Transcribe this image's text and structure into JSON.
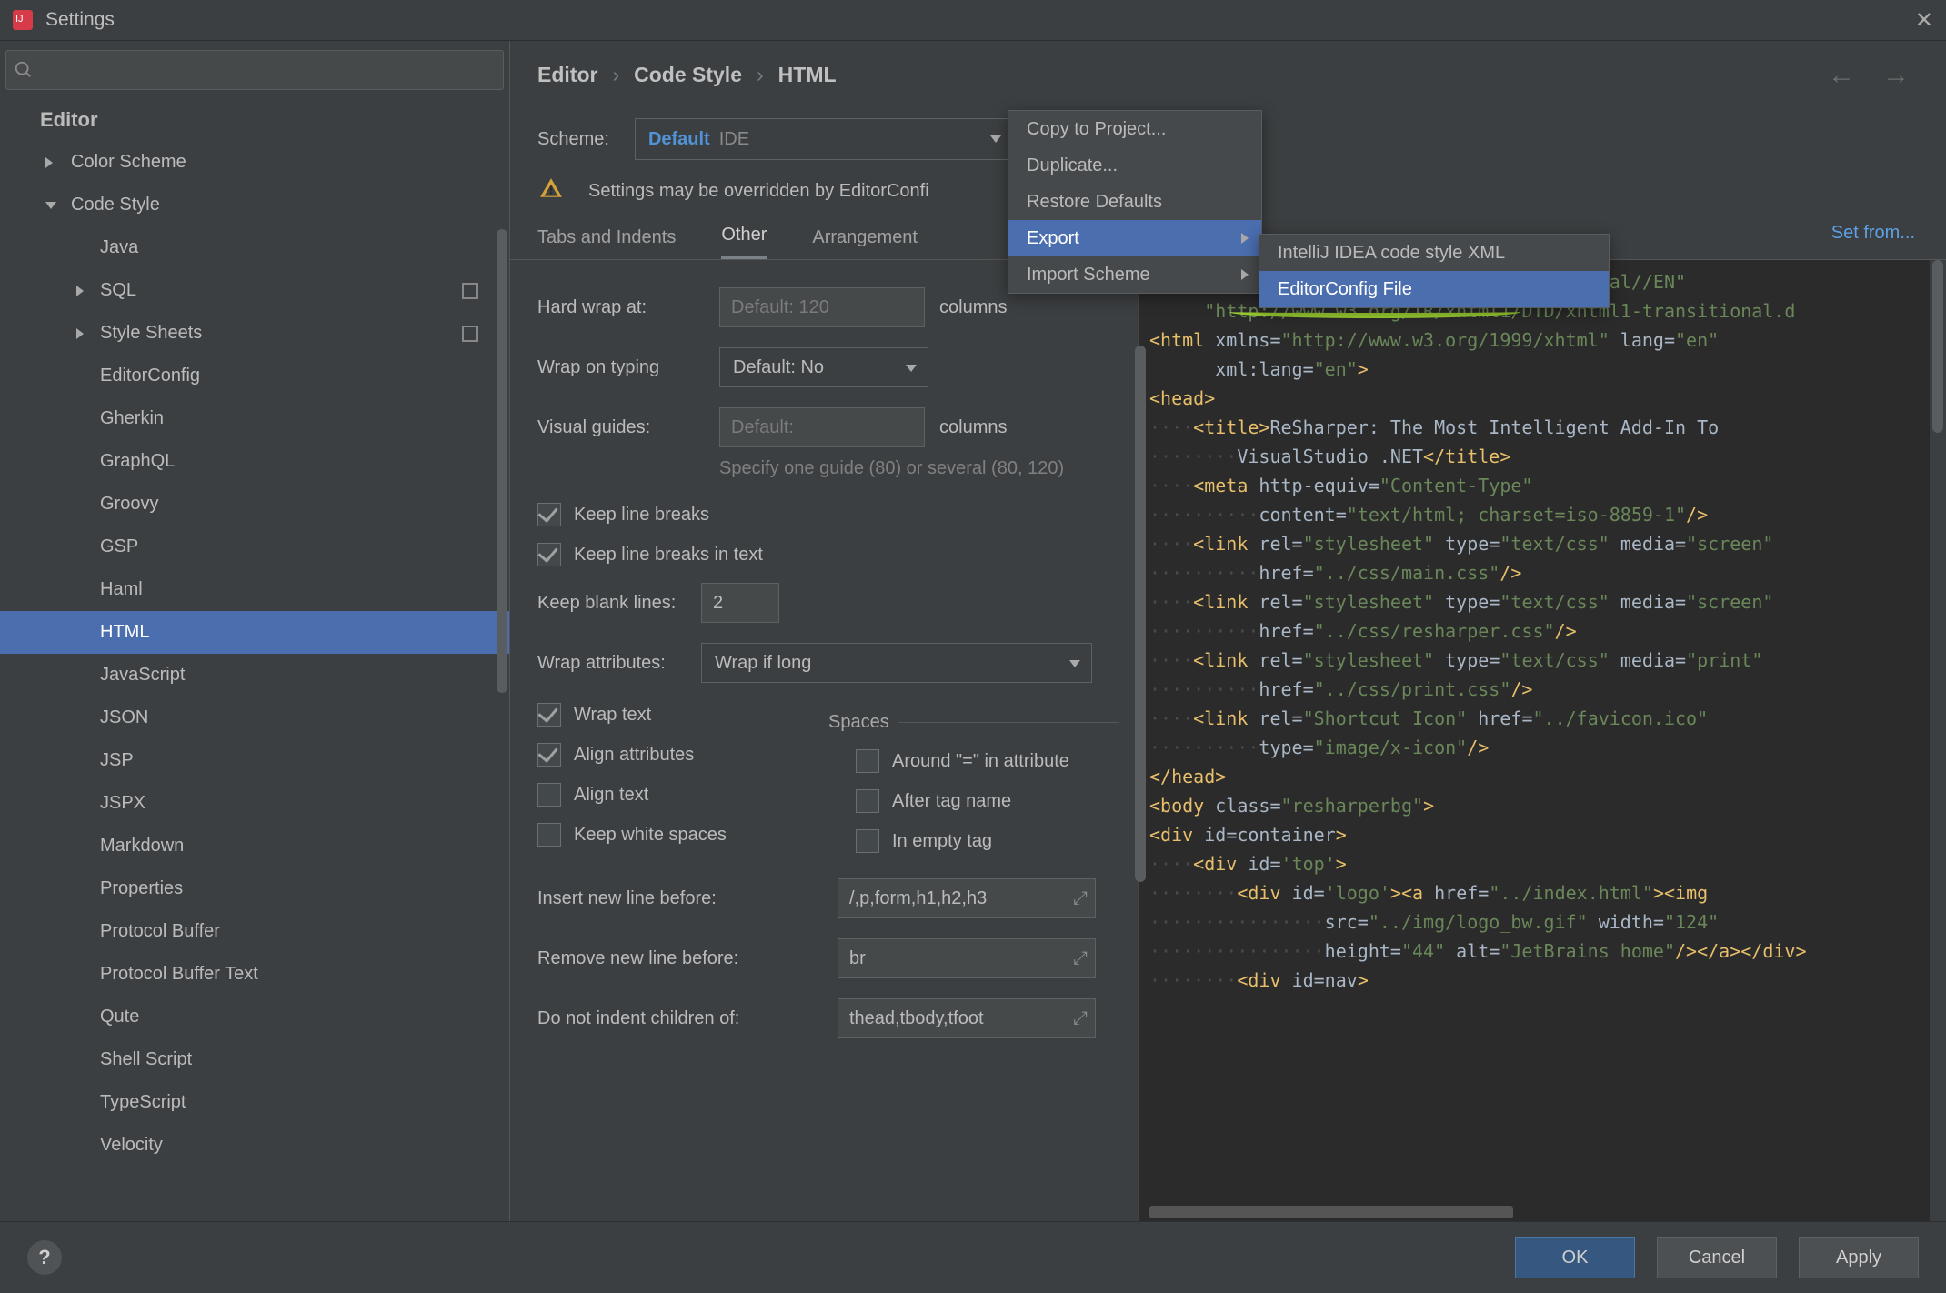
{
  "window": {
    "title": "Settings"
  },
  "sidebar": {
    "heading": "Editor",
    "items": [
      {
        "label": "Color Scheme",
        "indent": 2,
        "chev": "right"
      },
      {
        "label": "Code Style",
        "indent": 2,
        "chev": "down"
      },
      {
        "label": "Java",
        "indent": 3
      },
      {
        "label": "SQL",
        "indent": 3,
        "chev": "right",
        "badge": true
      },
      {
        "label": "Style Sheets",
        "indent": 3,
        "chev": "right",
        "badge": true
      },
      {
        "label": "EditorConfig",
        "indent": 3
      },
      {
        "label": "Gherkin",
        "indent": 3
      },
      {
        "label": "GraphQL",
        "indent": 3
      },
      {
        "label": "Groovy",
        "indent": 3
      },
      {
        "label": "GSP",
        "indent": 3
      },
      {
        "label": "Haml",
        "indent": 3
      },
      {
        "label": "HTML",
        "indent": 3,
        "selected": true
      },
      {
        "label": "JavaScript",
        "indent": 3
      },
      {
        "label": "JSON",
        "indent": 3
      },
      {
        "label": "JSP",
        "indent": 3
      },
      {
        "label": "JSPX",
        "indent": 3
      },
      {
        "label": "Markdown",
        "indent": 3
      },
      {
        "label": "Properties",
        "indent": 3
      },
      {
        "label": "Protocol Buffer",
        "indent": 3
      },
      {
        "label": "Protocol Buffer Text",
        "indent": 3
      },
      {
        "label": "Qute",
        "indent": 3
      },
      {
        "label": "Shell Script",
        "indent": 3
      },
      {
        "label": "TypeScript",
        "indent": 3
      },
      {
        "label": "Velocity",
        "indent": 3
      }
    ]
  },
  "breadcrumb": [
    "Editor",
    "Code Style",
    "HTML"
  ],
  "scheme": {
    "label": "Scheme:",
    "value_main": "Default",
    "value_suffix": "IDE"
  },
  "warning": "Settings may be overridden by EditorConfi",
  "set_from": "Set from...",
  "tabs": [
    "Tabs and Indents",
    "Other",
    "Arrangement"
  ],
  "active_tab": 1,
  "form": {
    "hard_wrap_label": "Hard wrap at:",
    "hard_wrap_placeholder": "Default: 120",
    "columns": "columns",
    "wrap_on_typing_label": "Wrap on typing",
    "wrap_on_typing_value": "Default: No",
    "visual_guides_label": "Visual guides:",
    "visual_guides_placeholder": "Default:",
    "visual_guides_hint": "Specify one guide (80) or several (80, 120)",
    "keep_line_breaks": "Keep line breaks",
    "keep_line_breaks_text": "Keep line breaks in text",
    "keep_blank_lines_label": "Keep blank lines:",
    "keep_blank_lines_value": "2",
    "wrap_attributes_label": "Wrap attributes:",
    "wrap_attributes_value": "Wrap if long",
    "wrap_text": "Wrap text",
    "align_attributes": "Align attributes",
    "align_text": "Align text",
    "keep_white_spaces": "Keep white spaces",
    "spaces_heading": "Spaces",
    "around_eq": "Around \"=\" in attribute",
    "after_tag_name": "After tag name",
    "in_empty_tag": "In empty tag",
    "insert_new_line_before_label": "Insert new line before:",
    "insert_new_line_before_value": "/,p,form,h1,h2,h3",
    "remove_new_line_before_label": "Remove new line before:",
    "remove_new_line_before_value": "br",
    "do_not_indent_label": "Do not indent children of:",
    "do_not_indent_value": "thead,tbody,tfoot"
  },
  "popup1": {
    "items": [
      {
        "label": "Copy to Project..."
      },
      {
        "label": "Duplicate..."
      },
      {
        "label": "Restore Defaults"
      },
      {
        "label": "Export",
        "sub": true,
        "hover": true
      },
      {
        "label": "Import Scheme",
        "sub": true
      }
    ]
  },
  "popup2": {
    "items": [
      {
        "label": "IntelliJ IDEA code style XML"
      },
      {
        "label": "EditorConfig File",
        "hover": true
      }
    ]
  },
  "footer": {
    "ok": "OK",
    "cancel": "Cancel",
    "apply": "Apply"
  },
  "code": [
    {
      "pre": "                                     ",
      "parts": [
        {
          "t": "itional//EN\"",
          "c": "str"
        }
      ]
    },
    {
      "pre": "     ",
      "parts": [
        {
          "t": "\"http://www.w3.org/TR/xhtml1/DTD/xhtml1-transitional.d",
          "c": "str"
        }
      ]
    },
    {
      "pre": "",
      "parts": [
        {
          "t": "<html ",
          "c": "tag"
        },
        {
          "t": "xmlns",
          "c": "attr"
        },
        {
          "t": "=",
          "c": "attr"
        },
        {
          "t": "\"http://www.w3.org/1999/xhtml\"",
          "c": "str"
        },
        {
          "t": " lang",
          "c": "attr"
        },
        {
          "t": "=",
          "c": "attr"
        },
        {
          "t": "\"en\"",
          "c": "str"
        }
      ]
    },
    {
      "pre": "      ",
      "parts": [
        {
          "t": "xml:lang",
          "c": "attr"
        },
        {
          "t": "=",
          "c": "attr"
        },
        {
          "t": "\"en\"",
          "c": "str"
        },
        {
          "t": ">",
          "c": "tag"
        }
      ]
    },
    {
      "pre": "",
      "parts": [
        {
          "t": "<head>",
          "c": "tag"
        }
      ]
    },
    {
      "pre": "....",
      "parts": [
        {
          "t": "<title>",
          "c": "tag"
        },
        {
          "t": "ReSharper: The Most Intelligent Add-In To",
          "c": "attr"
        }
      ]
    },
    {
      "pre": "........",
      "parts": [
        {
          "t": "VisualStudio .NET",
          "c": "attr"
        },
        {
          "t": "</title>",
          "c": "tag"
        }
      ]
    },
    {
      "pre": "....",
      "parts": [
        {
          "t": "<meta ",
          "c": "tag"
        },
        {
          "t": "http-equiv",
          "c": "attr"
        },
        {
          "t": "=",
          "c": "attr"
        },
        {
          "t": "\"Content-Type\"",
          "c": "str"
        }
      ]
    },
    {
      "pre": "..........",
      "parts": [
        {
          "t": "content",
          "c": "attr"
        },
        {
          "t": "=",
          "c": "attr"
        },
        {
          "t": "\"text/html; charset=iso-8859-1\"",
          "c": "str"
        },
        {
          "t": "/>",
          "c": "tag"
        }
      ]
    },
    {
      "pre": "....",
      "parts": [
        {
          "t": "<link ",
          "c": "tag"
        },
        {
          "t": "rel",
          "c": "attr"
        },
        {
          "t": "=",
          "c": "attr"
        },
        {
          "t": "\"stylesheet\"",
          "c": "str"
        },
        {
          "t": " type",
          "c": "attr"
        },
        {
          "t": "=",
          "c": "attr"
        },
        {
          "t": "\"text/css\"",
          "c": "str"
        },
        {
          "t": " media",
          "c": "attr"
        },
        {
          "t": "=",
          "c": "attr"
        },
        {
          "t": "\"screen\"",
          "c": "str"
        }
      ]
    },
    {
      "pre": "..........",
      "parts": [
        {
          "t": "href",
          "c": "attr"
        },
        {
          "t": "=",
          "c": "attr"
        },
        {
          "t": "\"../css/main.css\"",
          "c": "str"
        },
        {
          "t": "/>",
          "c": "tag"
        }
      ]
    },
    {
      "pre": "....",
      "parts": [
        {
          "t": "<link ",
          "c": "tag"
        },
        {
          "t": "rel",
          "c": "attr"
        },
        {
          "t": "=",
          "c": "attr"
        },
        {
          "t": "\"stylesheet\"",
          "c": "str"
        },
        {
          "t": " type",
          "c": "attr"
        },
        {
          "t": "=",
          "c": "attr"
        },
        {
          "t": "\"text/css\"",
          "c": "str"
        },
        {
          "t": " media",
          "c": "attr"
        },
        {
          "t": "=",
          "c": "attr"
        },
        {
          "t": "\"screen\"",
          "c": "str"
        }
      ]
    },
    {
      "pre": "..........",
      "parts": [
        {
          "t": "href",
          "c": "attr"
        },
        {
          "t": "=",
          "c": "attr"
        },
        {
          "t": "\"../css/resharper.css\"",
          "c": "str"
        },
        {
          "t": "/>",
          "c": "tag"
        }
      ]
    },
    {
      "pre": "....",
      "parts": [
        {
          "t": "<link ",
          "c": "tag"
        },
        {
          "t": "rel",
          "c": "attr"
        },
        {
          "t": "=",
          "c": "attr"
        },
        {
          "t": "\"stylesheet\"",
          "c": "str"
        },
        {
          "t": " type",
          "c": "attr"
        },
        {
          "t": "=",
          "c": "attr"
        },
        {
          "t": "\"text/css\"",
          "c": "str"
        },
        {
          "t": " media",
          "c": "attr"
        },
        {
          "t": "=",
          "c": "attr"
        },
        {
          "t": "\"print\"",
          "c": "str"
        }
      ]
    },
    {
      "pre": "..........",
      "parts": [
        {
          "t": "href",
          "c": "attr"
        },
        {
          "t": "=",
          "c": "attr"
        },
        {
          "t": "\"../css/print.css\"",
          "c": "str"
        },
        {
          "t": "/>",
          "c": "tag"
        }
      ]
    },
    {
      "pre": "....",
      "parts": [
        {
          "t": "<link ",
          "c": "tag"
        },
        {
          "t": "rel",
          "c": "attr"
        },
        {
          "t": "=",
          "c": "attr"
        },
        {
          "t": "\"Shortcut Icon\"",
          "c": "str"
        },
        {
          "t": " href",
          "c": "attr"
        },
        {
          "t": "=",
          "c": "attr"
        },
        {
          "t": "\"../favicon.ico\"",
          "c": "str"
        }
      ]
    },
    {
      "pre": "..........",
      "parts": [
        {
          "t": "type",
          "c": "attr"
        },
        {
          "t": "=",
          "c": "attr"
        },
        {
          "t": "\"image/x-icon\"",
          "c": "str"
        },
        {
          "t": "/>",
          "c": "tag"
        }
      ]
    },
    {
      "pre": "",
      "parts": []
    },
    {
      "pre": "",
      "parts": [
        {
          "t": "</head>",
          "c": "tag"
        }
      ]
    },
    {
      "pre": "",
      "parts": []
    },
    {
      "pre": "",
      "parts": [
        {
          "t": "<body ",
          "c": "tag"
        },
        {
          "t": "class",
          "c": "attr"
        },
        {
          "t": "=",
          "c": "attr"
        },
        {
          "t": "\"resharperbg\"",
          "c": "str"
        },
        {
          "t": ">",
          "c": "tag"
        }
      ]
    },
    {
      "pre": "",
      "parts": [
        {
          "t": "<div ",
          "c": "tag"
        },
        {
          "t": "id",
          "c": "attr"
        },
        {
          "t": "=container",
          "c": "attr"
        },
        {
          "t": ">",
          "c": "tag"
        }
      ]
    },
    {
      "pre": "",
      "parts": []
    },
    {
      "pre": "....",
      "parts": [
        {
          "t": "<div ",
          "c": "tag"
        },
        {
          "t": "id",
          "c": "attr"
        },
        {
          "t": "=",
          "c": "attr"
        },
        {
          "t": "'top'",
          "c": "str"
        },
        {
          "t": ">",
          "c": "tag"
        }
      ]
    },
    {
      "pre": "........",
      "parts": [
        {
          "t": "<div ",
          "c": "tag"
        },
        {
          "t": "id",
          "c": "attr"
        },
        {
          "t": "=",
          "c": "attr"
        },
        {
          "t": "'logo'",
          "c": "str"
        },
        {
          "t": "><a ",
          "c": "tag"
        },
        {
          "t": "href",
          "c": "attr"
        },
        {
          "t": "=",
          "c": "attr"
        },
        {
          "t": "\"../index.html\"",
          "c": "str"
        },
        {
          "t": "><img",
          "c": "tag"
        }
      ]
    },
    {
      "pre": "................",
      "parts": [
        {
          "t": "src",
          "c": "attr"
        },
        {
          "t": "=",
          "c": "attr"
        },
        {
          "t": "\"../img/logo_bw.gif\"",
          "c": "str"
        },
        {
          "t": " width",
          "c": "attr"
        },
        {
          "t": "=",
          "c": "attr"
        },
        {
          "t": "\"124\"",
          "c": "str"
        }
      ]
    },
    {
      "pre": "................",
      "parts": [
        {
          "t": "height",
          "c": "attr"
        },
        {
          "t": "=",
          "c": "attr"
        },
        {
          "t": "\"44\"",
          "c": "str"
        },
        {
          "t": " alt",
          "c": "attr"
        },
        {
          "t": "=",
          "c": "attr"
        },
        {
          "t": "\"JetBrains home\"",
          "c": "str"
        },
        {
          "t": "/></a></div>",
          "c": "tag"
        }
      ]
    },
    {
      "pre": "",
      "parts": []
    },
    {
      "pre": "........",
      "parts": [
        {
          "t": "<div ",
          "c": "tag"
        },
        {
          "t": "id",
          "c": "attr"
        },
        {
          "t": "=nav",
          "c": "attr"
        },
        {
          "t": ">",
          "c": "tag"
        }
      ]
    }
  ]
}
